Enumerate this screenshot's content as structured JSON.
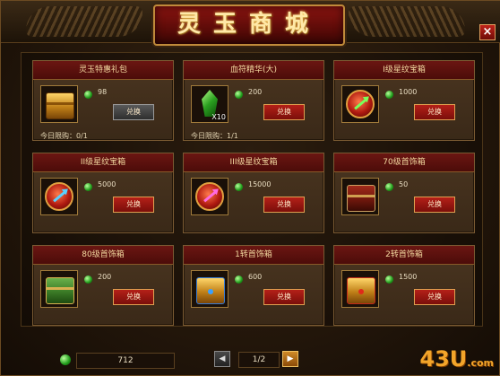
{
  "window": {
    "title": "灵玉商城",
    "close_glyph": "×"
  },
  "items": [
    {
      "name": "灵玉特惠礼包",
      "price": "98",
      "button": "兑换",
      "button_state": "disabled",
      "limit": "今日限购：0/1",
      "qty": "",
      "icon": "gold-chest-icon",
      "icon_style": "chest gold"
    },
    {
      "name": "血符精华(大)",
      "price": "200",
      "button": "兑换",
      "button_state": "enabled",
      "limit": "今日限购：1/1",
      "qty": "X10",
      "icon": "green-crystal-icon",
      "icon_style": "crystal"
    },
    {
      "name": "I级星纹宝箱",
      "price": "1000",
      "button": "兑换",
      "button_state": "enabled",
      "limit": "",
      "qty": "",
      "icon": "star-pattern-orb-icon",
      "icon_style": "orb",
      "arrow_color": "#7aff5a"
    },
    {
      "name": "II级星纹宝箱",
      "price": "5000",
      "button": "兑换",
      "button_state": "enabled",
      "limit": "",
      "qty": "",
      "icon": "star-pattern-orb-icon",
      "icon_style": "orb",
      "arrow_color": "#5ad0ff"
    },
    {
      "name": "III级星纹宝箱",
      "price": "15000",
      "button": "兑换",
      "button_state": "enabled",
      "limit": "",
      "qty": "",
      "icon": "star-pattern-orb-icon",
      "icon_style": "orb",
      "arrow_color": "#ff6ae0"
    },
    {
      "name": "70级首饰箱",
      "price": "50",
      "button": "兑换",
      "button_state": "enabled",
      "limit": "",
      "qty": "",
      "icon": "red-chest-icon",
      "icon_style": "chest red"
    },
    {
      "name": "80级首饰箱",
      "price": "200",
      "button": "兑换",
      "button_state": "enabled",
      "limit": "",
      "qty": "",
      "icon": "green-chest-icon",
      "icon_style": "chest green"
    },
    {
      "name": "1转首饰箱",
      "price": "600",
      "button": "兑换",
      "button_state": "enabled",
      "limit": "",
      "qty": "",
      "icon": "blue-gold-chest-icon",
      "icon_style": "chest bluegold"
    },
    {
      "name": "2转首饰箱",
      "price": "1500",
      "button": "兑换",
      "button_state": "enabled",
      "limit": "",
      "qty": "",
      "icon": "red-gold-chest-icon",
      "icon_style": "chest redgold"
    }
  ],
  "footer": {
    "balance": "712",
    "page": "1/2",
    "prev_glyph": "◀",
    "next_glyph": "▶",
    "watermark_main": "43U",
    "watermark_suffix": ".com"
  },
  "colors": {
    "accent_red": "#8a1410",
    "gold": "#c08a3a",
    "gem_green": "#1f9a1a"
  }
}
